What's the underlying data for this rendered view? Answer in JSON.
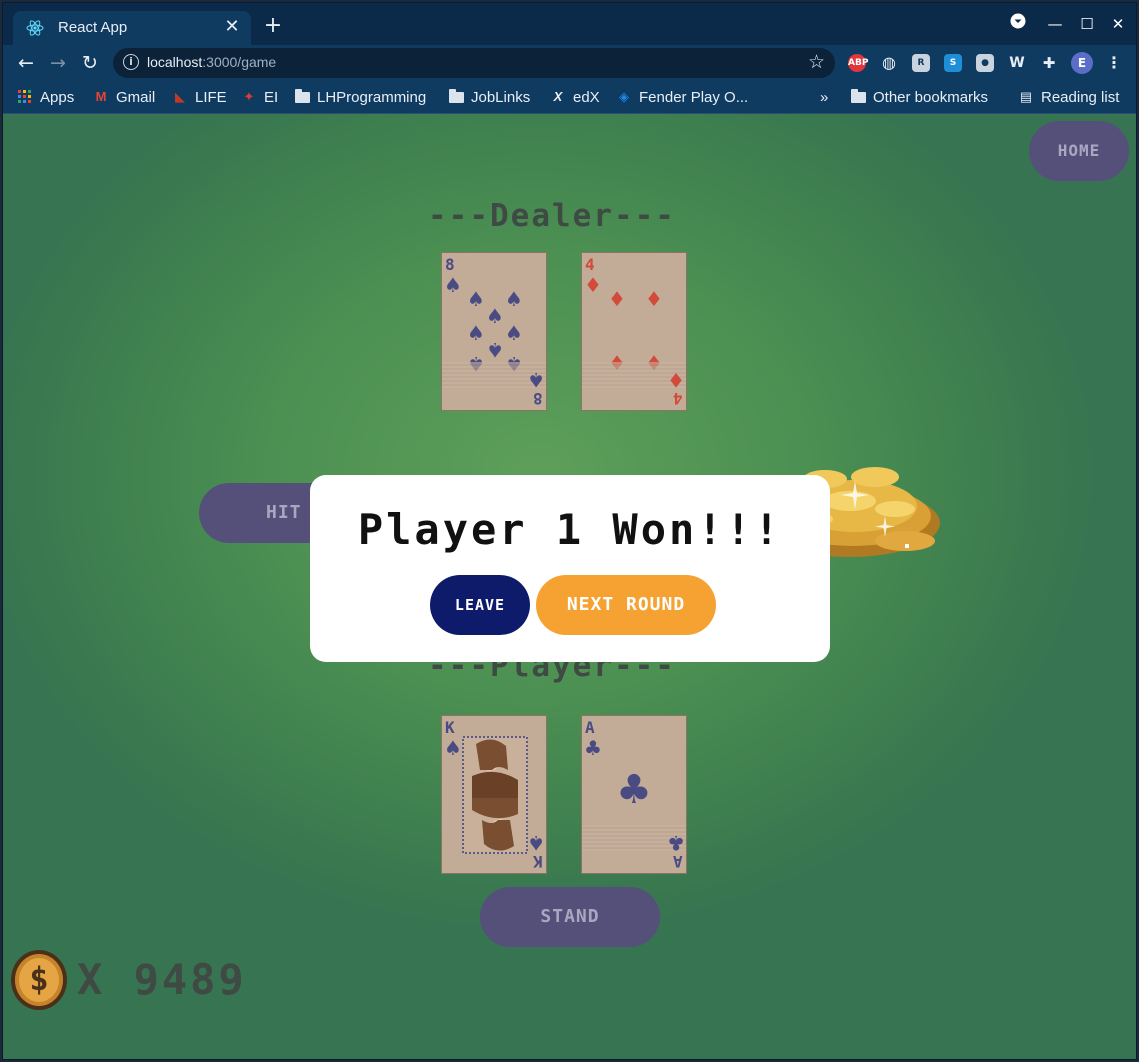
{
  "browser": {
    "tab_title": "React App",
    "url_host": "localhost",
    "url_path": ":3000/game"
  },
  "bookmarks": {
    "items": [
      {
        "label": "Apps",
        "icon": "apps-grid-icon"
      },
      {
        "label": "Gmail",
        "icon": "gmail-icon"
      },
      {
        "label": "LIFE",
        "icon": "shoe-icon"
      },
      {
        "label": "EI",
        "icon": "maple-leaf-icon"
      },
      {
        "label": "LHProgramming",
        "icon": "folder-icon"
      },
      {
        "label": "JobLinks",
        "icon": "folder-icon"
      },
      {
        "label": "edX",
        "icon": "edx-icon"
      },
      {
        "label": "Fender Play O...",
        "icon": "fender-icon"
      }
    ],
    "overflow": "»",
    "other": "Other bookmarks",
    "reading_list": "Reading list"
  },
  "game": {
    "home_label": "HOME",
    "dealer_label": "---Dealer---",
    "player_label": "---Player---",
    "hit_label": "HIT",
    "stand_label": "STAND",
    "money_text": "X 9489",
    "coin_symbol": "$",
    "dealer_cards": [
      {
        "rank": "8",
        "suit": "spades"
      },
      {
        "rank": "4",
        "suit": "diamonds"
      }
    ],
    "player_cards": [
      {
        "rank": "K",
        "suit": "spades"
      },
      {
        "rank": "A",
        "suit": "clubs"
      }
    ]
  },
  "modal": {
    "title": "Player 1 Won!!!",
    "leave_label": "LEAVE",
    "next_label": "NEXT ROUND"
  },
  "colors": {
    "table_green": "#4b8f52",
    "button_purple": "#55507a",
    "leave_navy": "#0e1b6b",
    "next_orange": "#f6a233"
  }
}
